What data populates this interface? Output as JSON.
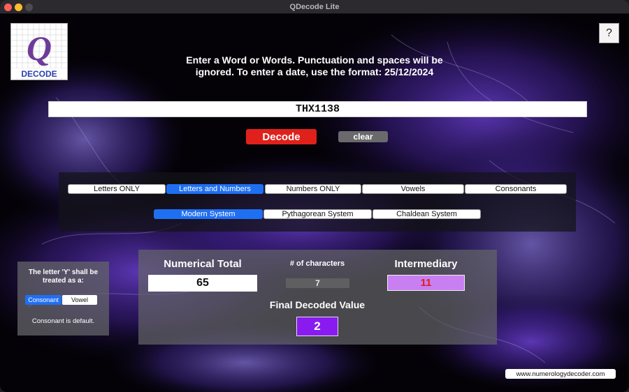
{
  "window": {
    "title": "QDecode Lite"
  },
  "logo": {
    "letter": "Q",
    "word": "DECODE"
  },
  "help_label": "?",
  "instructions": "Enter a Word or Words. Punctuation and spaces will be ignored. To enter a date, use the format: 25/12/2024",
  "input": {
    "value": "THX1138"
  },
  "buttons": {
    "decode": "Decode",
    "clear": "clear"
  },
  "filter_modes": [
    {
      "label": "Letters ONLY",
      "active": false
    },
    {
      "label": "Letters and Numbers",
      "active": true
    },
    {
      "label": "Numbers ONLY",
      "active": false
    },
    {
      "label": "Vowels",
      "active": false
    },
    {
      "label": "Consonants",
      "active": false
    }
  ],
  "systems": [
    {
      "label": "Modern System",
      "active": true
    },
    {
      "label": "Pythagorean System",
      "active": false
    },
    {
      "label": "Chaldean System",
      "active": false
    }
  ],
  "y_letter": {
    "label": "The letter 'Y' shall be treated as a:",
    "options": [
      {
        "label": "Consonant",
        "active": true
      },
      {
        "label": "Vowel",
        "active": false
      }
    ],
    "note": "Consonant is default."
  },
  "results": {
    "numerical_total_label": "Numerical Total",
    "numerical_total": "65",
    "chars_label": "# of characters",
    "chars": "7",
    "intermediary_label": "Intermediary",
    "intermediary": "11",
    "final_label": "Final Decoded Value",
    "final": "2"
  },
  "website": "www.numerologydecoder.com",
  "colors": {
    "decode": "#e0211b",
    "active_segment": "#1f6ff2",
    "intermediary_bg": "#c77ff2",
    "intermediary_text": "#e01d1d",
    "final_bg": "#8a1bf0"
  }
}
